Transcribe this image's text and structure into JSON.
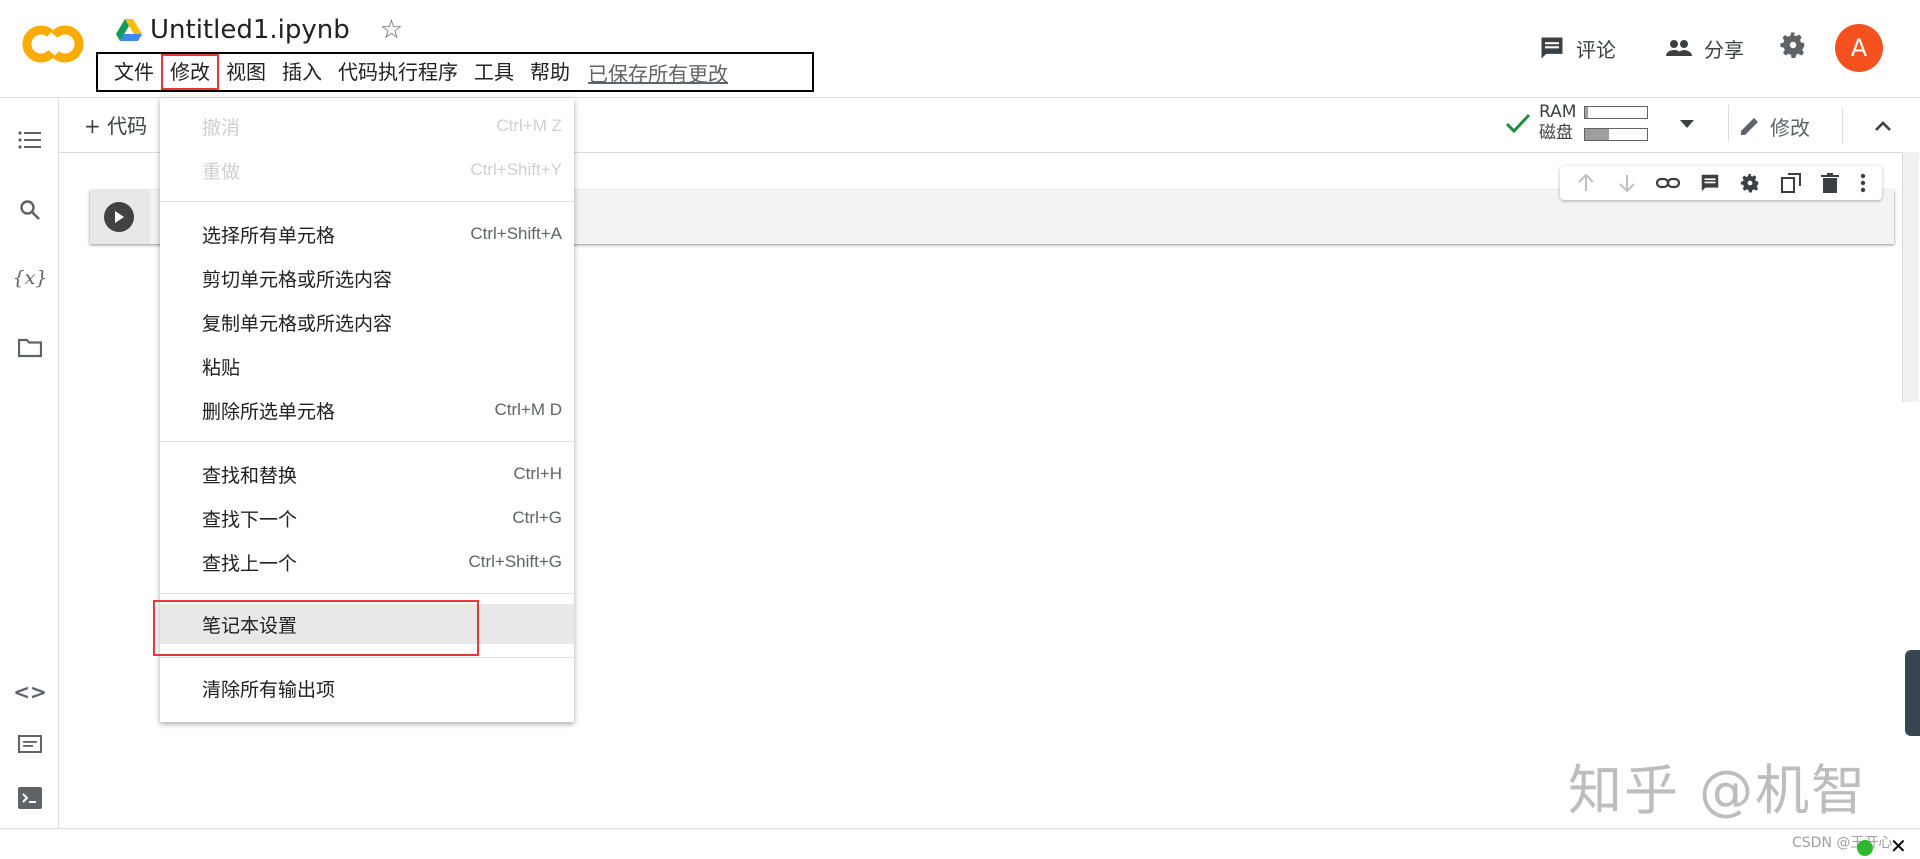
{
  "header": {
    "doc_title": "Untitled1.ipynb",
    "menu": [
      "文件",
      "修改",
      "视图",
      "插入",
      "代码执行程序",
      "工具",
      "帮助"
    ],
    "saved_status": "已保存所有更改",
    "comment_label": "评论",
    "share_label": "分享",
    "avatar_letter": "A"
  },
  "toolbar": {
    "add_code_label": "+ 代码",
    "ram_label": "RAM",
    "disk_label": "磁盘",
    "ram_fraction": 0.04,
    "disk_fraction": 0.38,
    "edit_label": "修改"
  },
  "dropdown": {
    "items": [
      {
        "label": "撤消",
        "shortcut": "Ctrl+M Z",
        "disabled": true
      },
      {
        "label": "重做",
        "shortcut": "Ctrl+Shift+Y",
        "disabled": true
      },
      {
        "label": "选择所有单元格",
        "shortcut": "Ctrl+Shift+A"
      },
      {
        "label": "剪切单元格或所选内容",
        "shortcut": ""
      },
      {
        "label": "复制单元格或所选内容",
        "shortcut": ""
      },
      {
        "label": "粘贴",
        "shortcut": ""
      },
      {
        "label": "删除所选单元格",
        "shortcut": "Ctrl+M D"
      },
      {
        "label": "查找和替换",
        "shortcut": "Ctrl+H"
      },
      {
        "label": "查找下一个",
        "shortcut": "Ctrl+G"
      },
      {
        "label": "查找上一个",
        "shortcut": "Ctrl+Shift+G"
      },
      {
        "label": "笔记本设置",
        "shortcut": "",
        "highlighted": true
      },
      {
        "label": "清除所有输出项",
        "shortcut": ""
      }
    ]
  },
  "watermark": "知乎 @机智",
  "csdn": "CSDN @王开心",
  "colors": {
    "accent_red": "#e53935",
    "avatar_bg": "#f4511e",
    "check_green": "#1e8e3e",
    "logo_orange": "#f9ab00"
  }
}
